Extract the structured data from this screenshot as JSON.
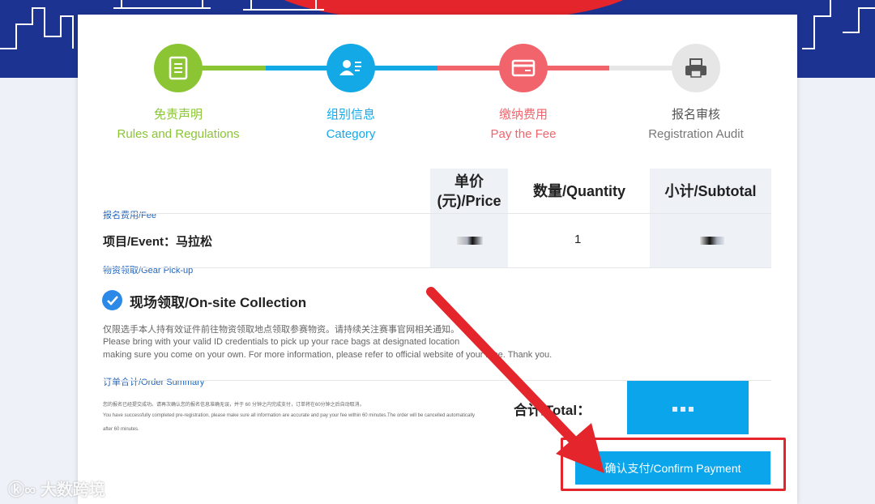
{
  "steps": [
    {
      "cn": "免责声明",
      "en": "Rules and Regulations",
      "color": "#8bc534",
      "icon": "document-icon"
    },
    {
      "cn": "组别信息",
      "en": "Category",
      "color": "#13a9e7",
      "icon": "user-card-icon"
    },
    {
      "cn": "缴纳费用",
      "en": "Pay the Fee",
      "color": "#f2646c",
      "icon": "credit-card-icon"
    },
    {
      "cn": "报名审核",
      "en": "Registration Audit",
      "color": "#e6e6e6",
      "icon": "printer-icon"
    }
  ],
  "table": {
    "price_header_line1": "单价",
    "price_header_line2": "(元)/Price",
    "quantity_header": "数量/Quantity",
    "subtotal_header": "小计/Subtotal"
  },
  "fee_section": {
    "title": "报名费用/Fee",
    "event_label": "项目/Event：马拉松",
    "quantity": "1"
  },
  "gear_section": {
    "title": "物资领取/Gear Pick-up",
    "option_label": "现场领取/On-site Collection",
    "note_cn": "仅限选手本人持有效证件前往物资领取地点领取参赛物资。请持续关注赛事官网相关通知。",
    "note_en_1": "Please bring with your valid ID credentials to pick up your race bags at designated location",
    "note_en_2": "making sure you come on your own. For more information, please refer to official website of your race. Thank you."
  },
  "summary": {
    "title": "订单合计/Order Summary",
    "note_cn": "您的报名已经提交成功。请再次确认您的报名信息准确无误，并于 60 分钟之内完成支付，订单将在60分钟之后自动取消。",
    "note_en_1": "You have successfully completed pre-registration, please make sure all information are accurate and pay your fee within 60 minutes.The order will be cancelled automatically",
    "note_en_2": "after 60 minutes.",
    "total_label": "合计/Total："
  },
  "confirm_button": "确认支付/Confirm Payment",
  "watermark": "大数跨境",
  "colors": {
    "accent": "#0aa5ea",
    "highlight": "#e4252b",
    "banner": "#1c3391"
  }
}
